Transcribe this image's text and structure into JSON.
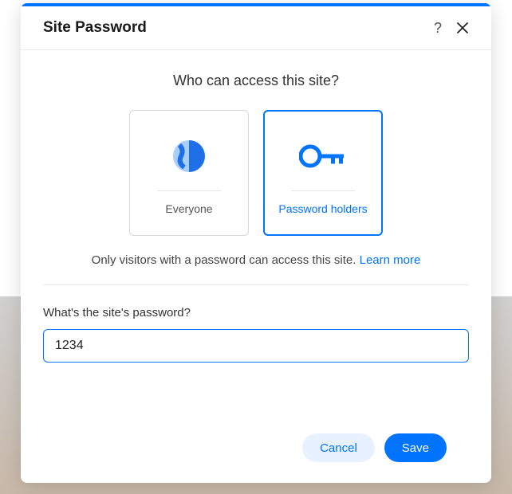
{
  "modal": {
    "title": "Site Password",
    "question": "Who can access this site?",
    "options": {
      "everyone": {
        "label": "Everyone"
      },
      "password_holders": {
        "label": "Password holders"
      }
    },
    "description": "Only visitors with a password can access this site. ",
    "learn_more": "Learn more",
    "input_label": "What's the site's password?",
    "password_value": "1234",
    "buttons": {
      "cancel": "Cancel",
      "save": "Save"
    }
  }
}
